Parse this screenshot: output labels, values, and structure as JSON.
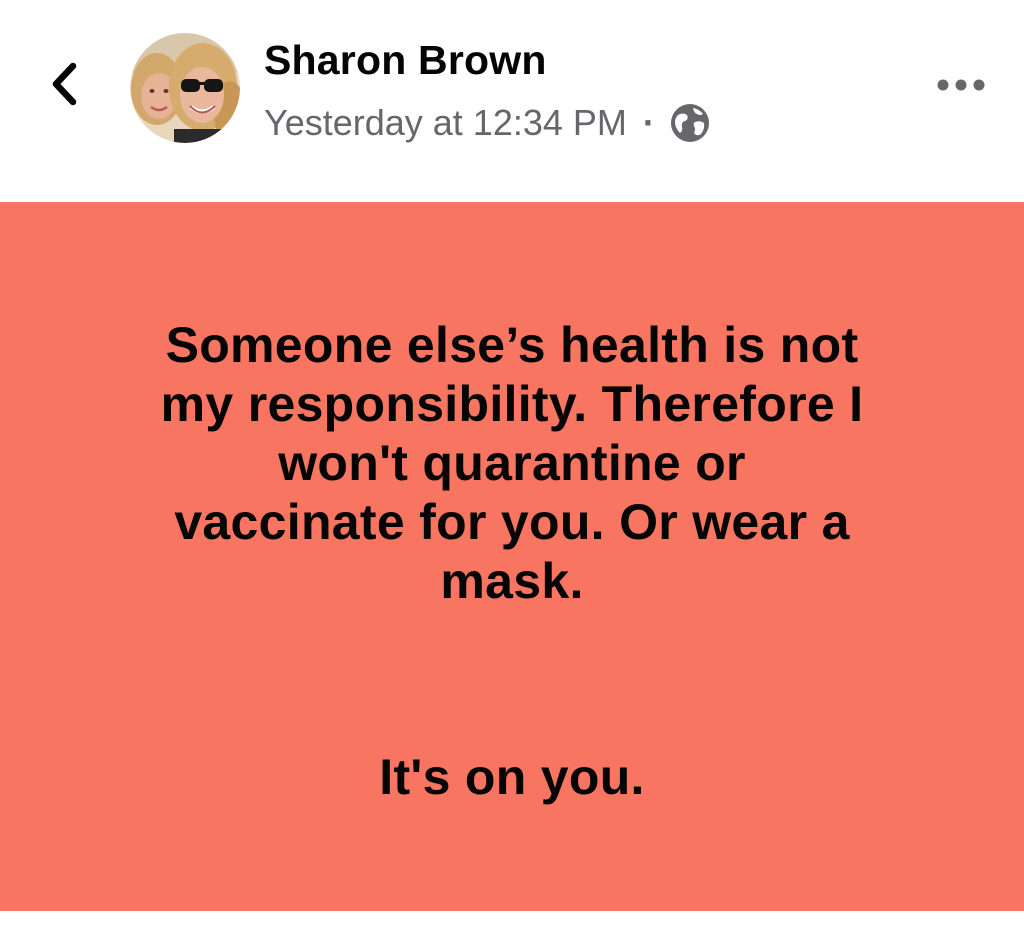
{
  "header": {
    "author": "Sharon Brown",
    "timestamp": "Yesterday at 12:34 PM",
    "separator": "·",
    "privacy_icon": "globe-icon",
    "back_icon": "chevron-left-icon",
    "more_icon": "more-horizontal-icon"
  },
  "post": {
    "background_color": "#f87561",
    "text_color": "#050505",
    "text_main": "Someone else’s health is not\nmy responsibility. Therefore I\nwon't quarantine or\nvaccinate for you. Or wear a\nmask.",
    "text_closing": "It's on you."
  }
}
